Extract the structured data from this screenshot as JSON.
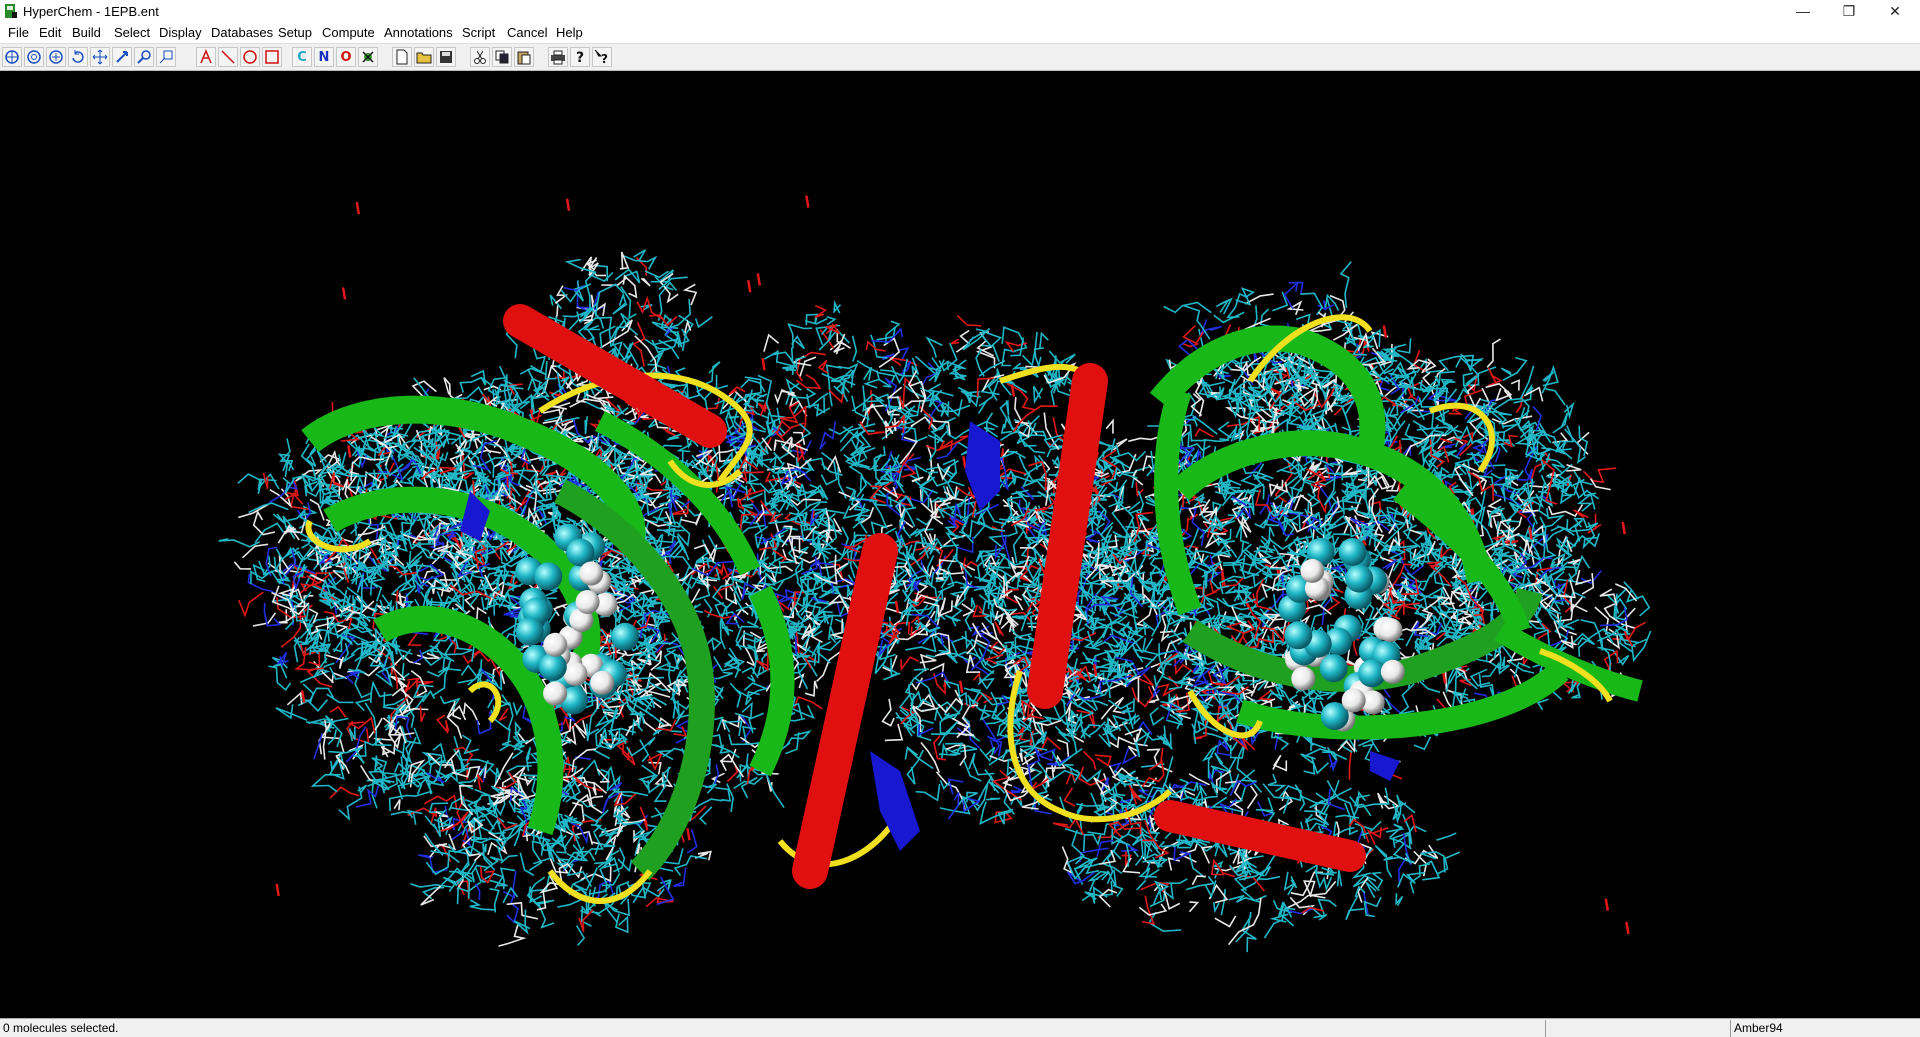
{
  "window": {
    "title": "HyperChem - 1EPB.ent",
    "minimize": "—",
    "restore": "❐",
    "close": "✕"
  },
  "menu": [
    "File",
    "Edit",
    "Build",
    "Select",
    "Display",
    "Databases",
    "Setup",
    "Compute",
    "Annotations",
    "Script",
    "Cancel",
    "Help"
  ],
  "toolbar": {
    "element_c": "C",
    "element_n": "N",
    "element_o": "O"
  },
  "status": {
    "message": "0 molecules selected.",
    "middle": "",
    "forcefield": "Amber94"
  },
  "colors": {
    "helix": "#e01010",
    "sheet": "#18b818",
    "coil": "#f0e020",
    "turn": "#1818d0",
    "carbon": "#20b8c8",
    "hydrogen": "#e8e8e8",
    "oxygen": "#e01818",
    "nitrogen": "#2030e0"
  }
}
